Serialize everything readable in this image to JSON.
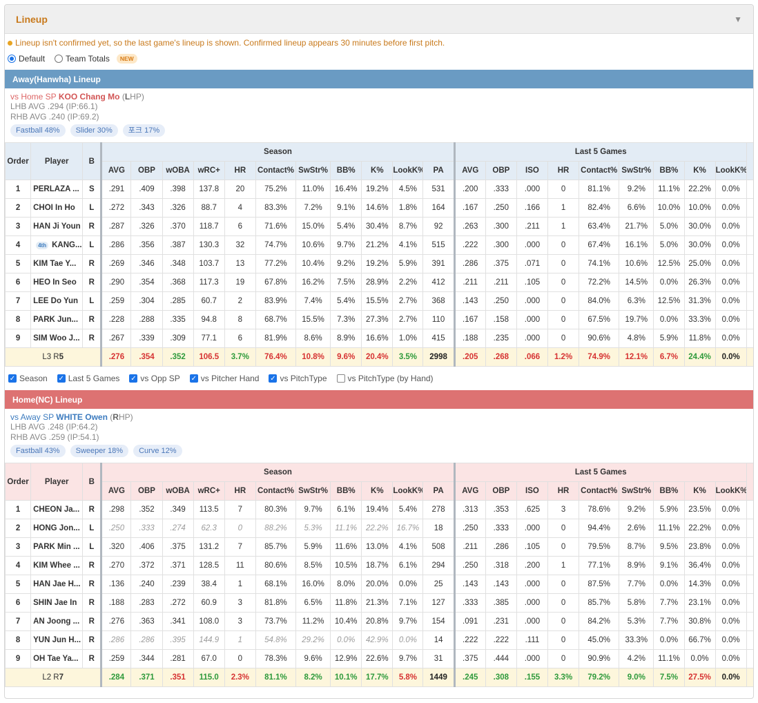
{
  "panel": {
    "title": "Lineup",
    "notice": "Lineup isn't confirmed yet, so the last game's lineup is shown. Confirmed lineup appears 30 minutes before first pitch.",
    "modes": [
      {
        "label": "Default",
        "checked": true
      },
      {
        "label": "Team Totals",
        "checked": false
      }
    ],
    "new_badge": "NEW"
  },
  "colors": {
    "away": "#6a9bc3",
    "home": "#dd7272",
    "accent": "#c8791b",
    "good": "#2e9a3b",
    "bad": "#d63232"
  },
  "headers": {
    "order": "Order",
    "player": "Player",
    "bat": "B",
    "season": "Season",
    "last5": "Last 5 Games",
    "season_cols": [
      "AVG",
      "OBP",
      "wOBA",
      "wRC+",
      "HR",
      "Contact%",
      "SwStr%",
      "BB%",
      "K%",
      "LookK%",
      "PA"
    ],
    "last5_cols": [
      "AVG",
      "OBP",
      "ISO",
      "HR",
      "Contact%",
      "SwStr%",
      "BB%",
      "K%",
      "LookK%"
    ]
  },
  "away": {
    "bar": "Away(Hanwha) Lineup",
    "sp": {
      "prefix": "vs Home SP ",
      "name": "KOO Chang Mo",
      "hand_open": " (",
      "hand": "L",
      "hand_rest": "HP)"
    },
    "lhb": "LHB AVG .294 (IP:66.1)",
    "rhb": "RHB AVG .240 (IP:69.2)",
    "pitches": [
      "Fastball 48%",
      "Slider 30%",
      "포크 17%"
    ],
    "rows": [
      {
        "o": "1",
        "p": "PERLAZA ...",
        "b": "S",
        "s": [
          ".291",
          ".409",
          ".398",
          "137.8",
          "20",
          "75.2%",
          "11.0%",
          "16.4%",
          "19.2%",
          "4.5%",
          "531"
        ],
        "l": [
          ".200",
          ".333",
          ".000",
          "0",
          "81.1%",
          "9.2%",
          "11.1%",
          "22.2%",
          "0.0%"
        ]
      },
      {
        "o": "2",
        "p": "CHOI In Ho",
        "b": "L",
        "s": [
          ".272",
          ".343",
          ".326",
          "88.7",
          "4",
          "83.3%",
          "7.2%",
          "9.1%",
          "14.6%",
          "1.8%",
          "164"
        ],
        "l": [
          ".167",
          ".250",
          ".166",
          "1",
          "82.4%",
          "6.6%",
          "10.0%",
          "10.0%",
          "0.0%"
        ]
      },
      {
        "o": "3",
        "p": "HAN Ji Youn",
        "b": "R",
        "s": [
          ".287",
          ".326",
          ".370",
          "118.7",
          "6",
          "71.6%",
          "15.0%",
          "5.4%",
          "30.4%",
          "8.7%",
          "92"
        ],
        "l": [
          ".263",
          ".300",
          ".211",
          "1",
          "63.4%",
          "21.7%",
          "5.0%",
          "30.0%",
          "0.0%"
        ]
      },
      {
        "o": "4",
        "p": "KANG...",
        "cap": "4th",
        "b": "L",
        "s": [
          ".286",
          ".356",
          ".387",
          "130.3",
          "32",
          "74.7%",
          "10.6%",
          "9.7%",
          "21.2%",
          "4.1%",
          "515"
        ],
        "l": [
          ".222",
          ".300",
          ".000",
          "0",
          "67.4%",
          "16.1%",
          "5.0%",
          "30.0%",
          "0.0%"
        ]
      },
      {
        "o": "5",
        "p": "KIM Tae Y...",
        "b": "R",
        "s": [
          ".269",
          ".346",
          ".348",
          "103.7",
          "13",
          "77.2%",
          "10.4%",
          "9.2%",
          "19.2%",
          "5.9%",
          "391"
        ],
        "l": [
          ".286",
          ".375",
          ".071",
          "0",
          "74.1%",
          "10.6%",
          "12.5%",
          "25.0%",
          "0.0%"
        ]
      },
      {
        "o": "6",
        "p": "HEO In Seo",
        "b": "R",
        "s": [
          ".290",
          ".354",
          ".368",
          "117.3",
          "19",
          "67.8%",
          "16.2%",
          "7.5%",
          "28.9%",
          "2.2%",
          "412"
        ],
        "l": [
          ".211",
          ".211",
          ".105",
          "0",
          "72.2%",
          "14.5%",
          "0.0%",
          "26.3%",
          "0.0%"
        ]
      },
      {
        "o": "7",
        "p": "LEE Do Yun",
        "b": "L",
        "s": [
          ".259",
          ".304",
          ".285",
          "60.7",
          "2",
          "83.9%",
          "7.4%",
          "5.4%",
          "15.5%",
          "2.7%",
          "368"
        ],
        "l": [
          ".143",
          ".250",
          ".000",
          "0",
          "84.0%",
          "6.3%",
          "12.5%",
          "31.3%",
          "0.0%"
        ]
      },
      {
        "o": "8",
        "p": "PARK Jun...",
        "b": "R",
        "s": [
          ".228",
          ".288",
          ".335",
          "94.8",
          "8",
          "68.7%",
          "15.5%",
          "7.3%",
          "27.3%",
          "2.7%",
          "110"
        ],
        "l": [
          ".167",
          ".158",
          ".000",
          "0",
          "67.5%",
          "19.7%",
          "0.0%",
          "33.3%",
          "0.0%"
        ]
      },
      {
        "o": "9",
        "p": "SIM Woo J...",
        "b": "R",
        "s": [
          ".267",
          ".339",
          ".309",
          "77.1",
          "6",
          "81.9%",
          "8.6%",
          "8.9%",
          "16.6%",
          "1.0%",
          "415"
        ],
        "l": [
          ".188",
          ".235",
          ".000",
          "0",
          "90.6%",
          "4.8%",
          "5.9%",
          "11.8%",
          "0.0%"
        ]
      }
    ],
    "totals": {
      "lr_l": "L3 R",
      "lr_r": "5",
      "s": [
        ".276",
        ".354",
        ".352",
        "106.5",
        "3.7%",
        "76.4%",
        "10.8%",
        "9.6%",
        "20.4%",
        "3.5%",
        "2998"
      ],
      "s_cls": [
        "red",
        "red",
        "green",
        "red",
        "green",
        "red",
        "red",
        "red",
        "red",
        "green",
        "blk"
      ],
      "l": [
        ".205",
        ".268",
        ".066",
        "1.2%",
        "74.9%",
        "12.1%",
        "6.7%",
        "24.4%",
        "0.0%"
      ],
      "l_cls": [
        "red",
        "red",
        "red",
        "red",
        "red",
        "red",
        "red",
        "green",
        "blk"
      ]
    }
  },
  "checks": [
    {
      "label": "Season",
      "on": true
    },
    {
      "label": "Last 5 Games",
      "on": true
    },
    {
      "label": "vs Opp SP",
      "on": true
    },
    {
      "label": "vs Pitcher Hand",
      "on": true
    },
    {
      "label": "vs PitchType",
      "on": true
    },
    {
      "label": "vs PitchType (by Hand)",
      "on": false
    }
  ],
  "home": {
    "bar": "Home(NC) Lineup",
    "sp": {
      "prefix": "vs Away SP ",
      "name": "WHITE Owen",
      "hand_open": " (",
      "hand": "R",
      "hand_rest": "HP)"
    },
    "lhb": "LHB AVG .248 (IP:64.2)",
    "rhb": "RHB AVG .259 (IP:54.1)",
    "pitches": [
      "Fastball 43%",
      "Sweeper 18%",
      "Curve 12%"
    ],
    "rows": [
      {
        "o": "1",
        "p": "CHEON Ja...",
        "b": "R",
        "s": [
          ".298",
          ".352",
          ".349",
          "113.5",
          "7",
          "80.3%",
          "9.7%",
          "6.1%",
          "19.4%",
          "5.4%",
          "278"
        ],
        "l": [
          ".313",
          ".353",
          ".625",
          "3",
          "78.6%",
          "9.2%",
          "5.9%",
          "23.5%",
          "0.0%"
        ]
      },
      {
        "o": "2",
        "p": "HONG Jon...",
        "b": "L",
        "dim": true,
        "s": [
          ".250",
          ".333",
          ".274",
          "62.3",
          "0",
          "88.2%",
          "5.3%",
          "11.1%",
          "22.2%",
          "16.7%",
          "18"
        ],
        "l": [
          ".250",
          ".333",
          ".000",
          "0",
          "94.4%",
          "2.6%",
          "11.1%",
          "22.2%",
          "0.0%"
        ]
      },
      {
        "o": "3",
        "p": "PARK Min ...",
        "b": "L",
        "s": [
          ".320",
          ".406",
          ".375",
          "131.2",
          "7",
          "85.7%",
          "5.9%",
          "11.6%",
          "13.0%",
          "4.1%",
          "508"
        ],
        "l": [
          ".211",
          ".286",
          ".105",
          "0",
          "79.5%",
          "8.7%",
          "9.5%",
          "23.8%",
          "0.0%"
        ]
      },
      {
        "o": "4",
        "p": "KIM Whee ...",
        "b": "R",
        "s": [
          ".270",
          ".372",
          ".371",
          "128.5",
          "11",
          "80.6%",
          "8.5%",
          "10.5%",
          "18.7%",
          "6.1%",
          "294"
        ],
        "l": [
          ".250",
          ".318",
          ".200",
          "1",
          "77.1%",
          "8.9%",
          "9.1%",
          "36.4%",
          "0.0%"
        ]
      },
      {
        "o": "5",
        "p": "HAN Jae H...",
        "b": "R",
        "s": [
          ".136",
          ".240",
          ".239",
          "38.4",
          "1",
          "68.1%",
          "16.0%",
          "8.0%",
          "20.0%",
          "0.0%",
          "25"
        ],
        "l": [
          ".143",
          ".143",
          ".000",
          "0",
          "87.5%",
          "7.7%",
          "0.0%",
          "14.3%",
          "0.0%"
        ]
      },
      {
        "o": "6",
        "p": "SHIN Jae In",
        "b": "R",
        "s": [
          ".188",
          ".283",
          ".272",
          "60.9",
          "3",
          "81.8%",
          "6.5%",
          "11.8%",
          "21.3%",
          "7.1%",
          "127"
        ],
        "l": [
          ".333",
          ".385",
          ".000",
          "0",
          "85.7%",
          "5.8%",
          "7.7%",
          "23.1%",
          "0.0%"
        ]
      },
      {
        "o": "7",
        "p": "AN Joong ...",
        "b": "R",
        "s": [
          ".276",
          ".363",
          ".341",
          "108.0",
          "3",
          "73.7%",
          "11.2%",
          "10.4%",
          "20.8%",
          "9.7%",
          "154"
        ],
        "l": [
          ".091",
          ".231",
          ".000",
          "0",
          "84.2%",
          "5.3%",
          "7.7%",
          "30.8%",
          "0.0%"
        ]
      },
      {
        "o": "8",
        "p": "YUN Jun H...",
        "b": "R",
        "dim": true,
        "s": [
          ".286",
          ".286",
          ".395",
          "144.9",
          "1",
          "54.8%",
          "29.2%",
          "0.0%",
          "42.9%",
          "0.0%",
          "14"
        ],
        "l": [
          ".222",
          ".222",
          ".111",
          "0",
          "45.0%",
          "33.3%",
          "0.0%",
          "66.7%",
          "0.0%"
        ]
      },
      {
        "o": "9",
        "p": "OH Tae Ya...",
        "b": "R",
        "s": [
          ".259",
          ".344",
          ".281",
          "67.0",
          "0",
          "78.3%",
          "9.6%",
          "12.9%",
          "22.6%",
          "9.7%",
          "31"
        ],
        "l": [
          ".375",
          ".444",
          ".000",
          "0",
          "90.9%",
          "4.2%",
          "11.1%",
          "0.0%",
          "0.0%"
        ]
      }
    ],
    "totals": {
      "lr_l": "L2 R",
      "lr_r": "7",
      "s": [
        ".284",
        ".371",
        ".351",
        "115.0",
        "2.3%",
        "81.1%",
        "8.2%",
        "10.1%",
        "17.7%",
        "5.8%",
        "1449"
      ],
      "s_cls": [
        "green",
        "green",
        "red",
        "green",
        "red",
        "green",
        "green",
        "green",
        "green",
        "red",
        "blk"
      ],
      "l": [
        ".245",
        ".308",
        ".155",
        "3.3%",
        "79.2%",
        "9.0%",
        "7.5%",
        "27.5%",
        "0.0%"
      ],
      "l_cls": [
        "green",
        "green",
        "green",
        "green",
        "green",
        "green",
        "green",
        "red",
        "blk"
      ]
    }
  }
}
